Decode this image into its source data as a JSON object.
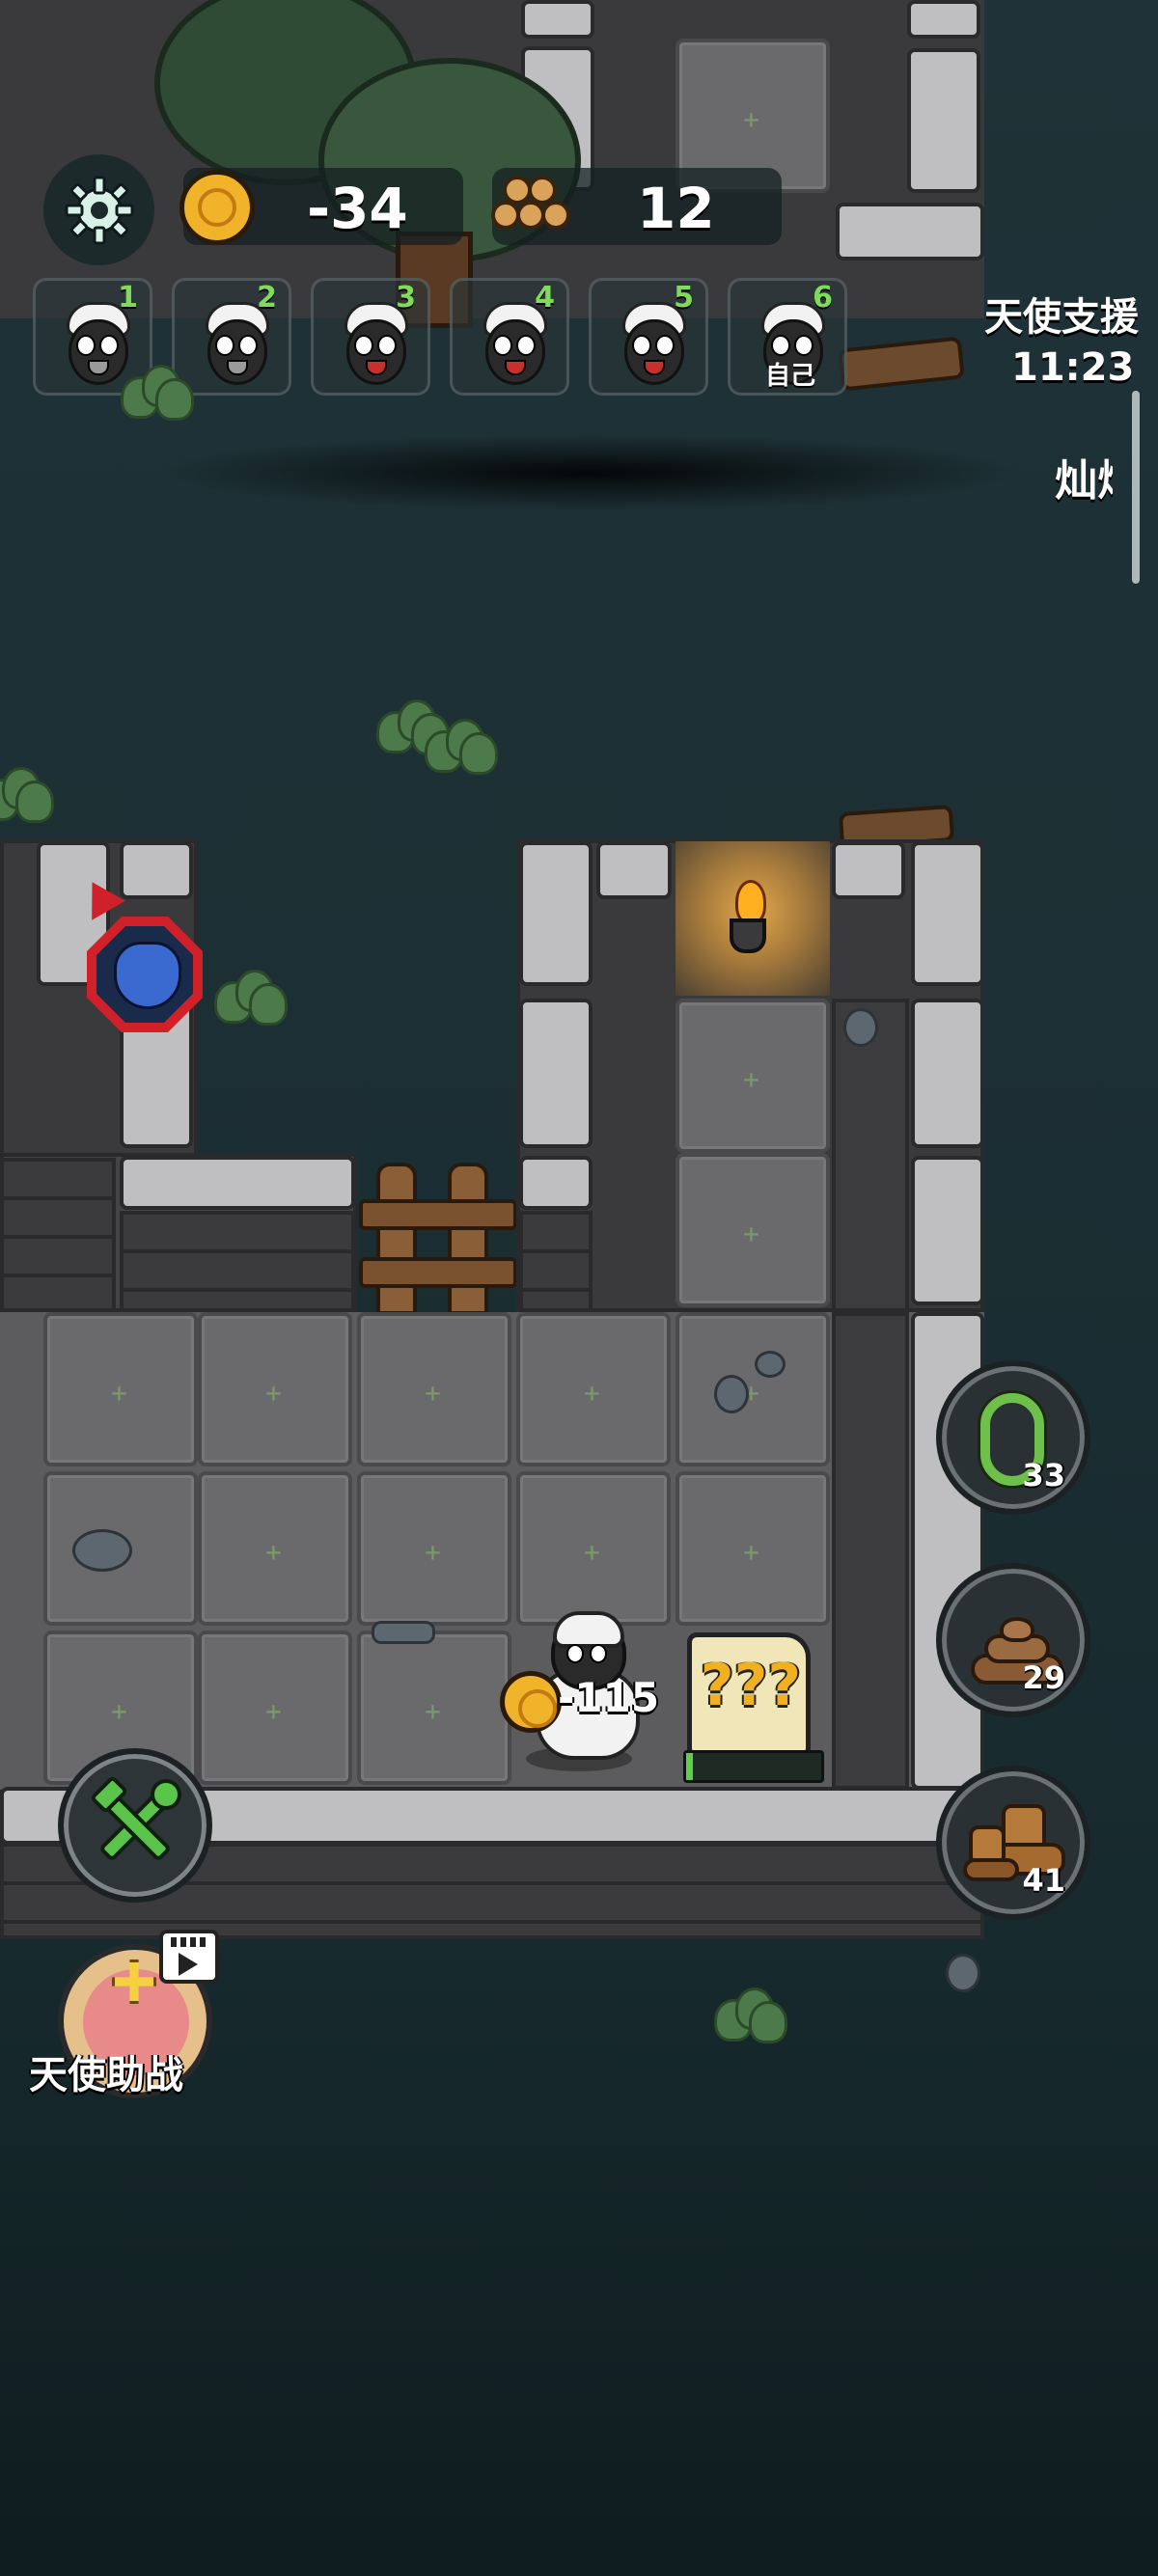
{
  "hud": {
    "coins": "-34",
    "wood": "12",
    "settings_icon": "gear-icon",
    "coin_icon": "gold-coin-icon",
    "wood_icon": "log-pile-icon"
  },
  "players": [
    {
      "rank": "1",
      "label": ""
    },
    {
      "rank": "2",
      "label": ""
    },
    {
      "rank": "3",
      "label": ""
    },
    {
      "rank": "4",
      "label": ""
    },
    {
      "rank": "5",
      "label": ""
    },
    {
      "rank": "6",
      "label": "自己"
    }
  ],
  "angel_support": {
    "title": "天使支援",
    "timer": "11:23",
    "side_text": "灿烂"
  },
  "board": {
    "sheep_coin_change": "-115",
    "mystery_card_text": "???",
    "mystery_progress": 0.05
  },
  "abilities": [
    {
      "name": "thorn-vine",
      "count": "33"
    },
    {
      "name": "poop",
      "count": "29"
    },
    {
      "name": "boots",
      "count": "41"
    }
  ],
  "bottom": {
    "angel_help_label": "天使助战",
    "build_icon": "wrench-hammer-icon",
    "video_icon": "video-ad-icon"
  },
  "colors": {
    "background": "#1e3237",
    "stone": "#6a6a6c",
    "wall_top": "#bfbfc1",
    "green_accent": "#7fdc5a",
    "coin_gold": "#f0b32a",
    "wolf_red": "#d0202a"
  }
}
